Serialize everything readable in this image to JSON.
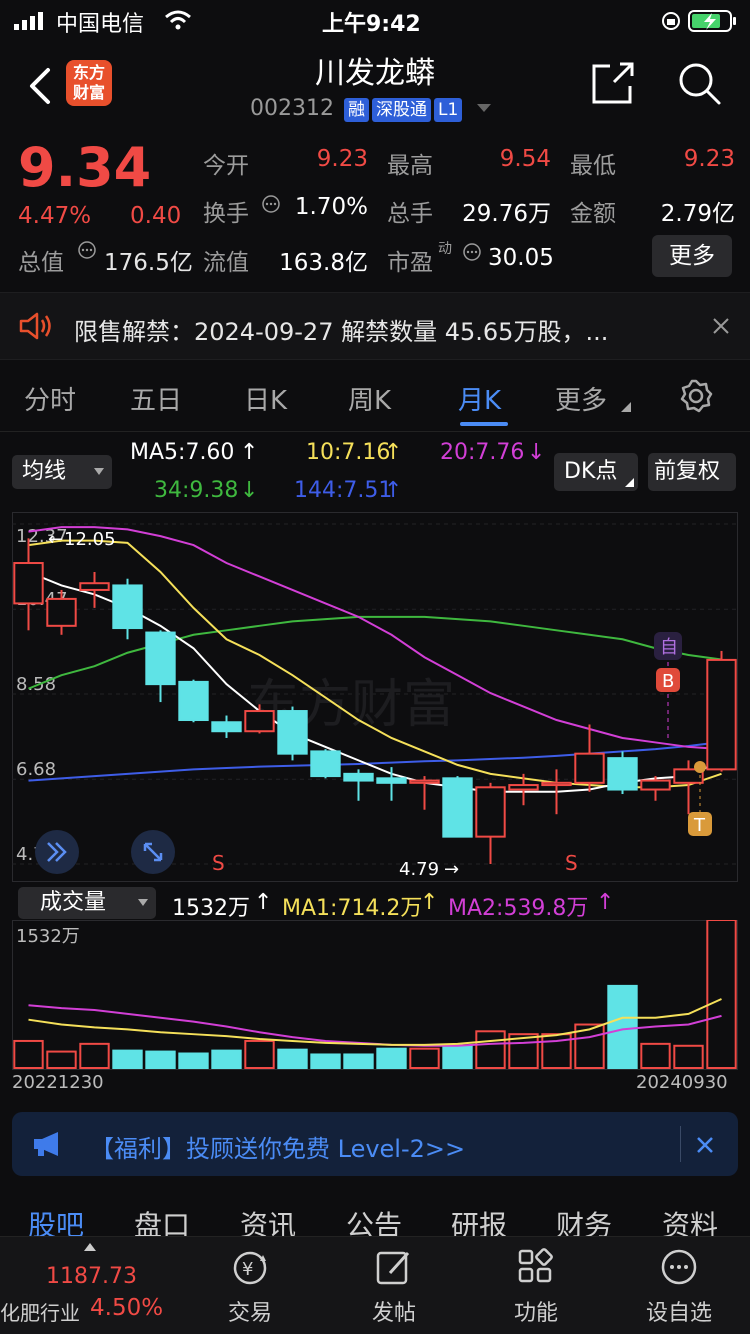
{
  "status_bar": {
    "carrier": "中国电信",
    "time": "上午9:42"
  },
  "header": {
    "logo_text": "东方财富",
    "title": "川发龙蟒",
    "code": "002312",
    "tags": [
      "融",
      "深股通",
      "L1"
    ]
  },
  "quote": {
    "price": "9.34",
    "change_pct": "4.47%",
    "change": "0.40",
    "fields": {
      "open_label": "今开",
      "open": "9.23",
      "high_label": "最高",
      "high": "9.54",
      "low_label": "最低",
      "low": "9.23",
      "turnover_label": "换手",
      "turnover": "1.70%",
      "volume_label": "总手",
      "volume": "29.76万",
      "amount_label": "金额",
      "amount": "2.79亿",
      "mktcap_label": "总值",
      "mktcap": "176.5亿",
      "float_label": "流值",
      "float": "163.8亿",
      "pe_label": "市盈",
      "pe_sup": "动",
      "pe": "30.05"
    },
    "more_button": "更多"
  },
  "notice": {
    "text": "限售解禁：2024-09-27 解禁数量 45.65万股，..."
  },
  "period_tabs": [
    "分时",
    "五日",
    "日K",
    "周K",
    "月K",
    "更多"
  ],
  "indicators": {
    "ma_selector": "均线",
    "ma5": "MA5:7.60",
    "ma10": "10:7.16",
    "ma20": "20:7.76",
    "ma34": "34:9.38",
    "ma144": "144:7.51",
    "dk_button": "DK点",
    "adjust_button": "前复权",
    "colors": {
      "ma5": "#ffffff",
      "ma10": "#f5e05a",
      "ma20": "#d23fd6",
      "ma34": "#3fb83f",
      "ma144": "#3e5de8",
      "up": "#f04a45",
      "down": "#5fe3e6"
    }
  },
  "chart_data": [
    {
      "type": "candlestick",
      "title": "",
      "y_ticks": [
        "12.37",
        "10.47",
        "8.58",
        "6.68",
        "4.79"
      ],
      "ylim": [
        4.79,
        12.37
      ],
      "annotations": {
        "high_marker": "12.05",
        "low_marker": "4.79",
        "s_marks": [
          "S",
          "S"
        ],
        "b_mark": "B",
        "t_mark": "T",
        "watermark": "东方财富",
        "self_mark": "自"
      },
      "candles": [
        {
          "o": 10.6,
          "h": 12.05,
          "l": 10.0,
          "c": 11.5
        },
        {
          "o": 10.1,
          "h": 10.9,
          "l": 9.9,
          "c": 10.7
        },
        {
          "o": 10.9,
          "h": 11.3,
          "l": 10.5,
          "c": 11.05
        },
        {
          "o": 11.0,
          "h": 11.15,
          "l": 9.8,
          "c": 10.05
        },
        {
          "o": 9.95,
          "h": 10.0,
          "l": 8.4,
          "c": 8.8
        },
        {
          "o": 8.85,
          "h": 8.9,
          "l": 7.95,
          "c": 8.0
        },
        {
          "o": 7.95,
          "h": 8.1,
          "l": 7.6,
          "c": 7.75
        },
        {
          "o": 7.75,
          "h": 8.35,
          "l": 7.7,
          "c": 8.2
        },
        {
          "o": 8.2,
          "h": 8.3,
          "l": 7.1,
          "c": 7.25
        },
        {
          "o": 7.3,
          "h": 7.35,
          "l": 6.7,
          "c": 6.75
        },
        {
          "o": 6.8,
          "h": 6.9,
          "l": 6.2,
          "c": 6.65
        },
        {
          "o": 6.7,
          "h": 6.95,
          "l": 6.2,
          "c": 6.6
        },
        {
          "o": 6.6,
          "h": 6.75,
          "l": 6.0,
          "c": 6.65
        },
        {
          "o": 6.7,
          "h": 6.75,
          "l": 5.4,
          "c": 5.4
        },
        {
          "o": 5.4,
          "h": 6.6,
          "l": 4.79,
          "c": 6.5
        },
        {
          "o": 6.45,
          "h": 6.8,
          "l": 6.1,
          "c": 6.55
        },
        {
          "o": 6.55,
          "h": 6.9,
          "l": 5.9,
          "c": 6.6
        },
        {
          "o": 6.6,
          "h": 7.9,
          "l": 6.4,
          "c": 7.25
        },
        {
          "o": 7.15,
          "h": 7.3,
          "l": 6.35,
          "c": 6.45
        },
        {
          "o": 6.45,
          "h": 6.75,
          "l": 6.2,
          "c": 6.65
        },
        {
          "o": 6.6,
          "h": 7.1,
          "l": 5.9,
          "c": 6.9
        },
        {
          "o": 6.9,
          "h": 9.54,
          "l": 6.85,
          "c": 9.34
        }
      ],
      "ma_lines": {
        "ma5": [
          11.3,
          11.0,
          10.8,
          10.5,
          10.1,
          9.6,
          8.8,
          8.2,
          7.7,
          7.4,
          7.1,
          6.8,
          6.6,
          6.5,
          6.4,
          6.4,
          6.4,
          6.45,
          6.6,
          6.7,
          6.75,
          7.1
        ],
        "ma10": [
          11.9,
          12.0,
          12.0,
          11.95,
          11.3,
          10.5,
          9.8,
          9.45,
          9.0,
          8.5,
          8.0,
          7.6,
          7.3,
          7.0,
          6.8,
          6.7,
          6.6,
          6.55,
          6.5,
          6.5,
          6.55,
          6.8
        ],
        "ma20": [
          12.2,
          12.3,
          12.3,
          12.25,
          12.1,
          11.9,
          11.5,
          11.2,
          10.9,
          10.6,
          10.3,
          9.9,
          9.4,
          9.0,
          8.6,
          8.3,
          8.0,
          7.8,
          7.6,
          7.5,
          7.4,
          7.35
        ],
        "ma34": [
          8.7,
          9.0,
          9.2,
          9.5,
          9.7,
          9.9,
          10.0,
          10.1,
          10.2,
          10.25,
          10.3,
          10.3,
          10.3,
          10.25,
          10.2,
          10.1,
          10.0,
          9.9,
          9.8,
          9.6,
          9.45,
          9.35
        ],
        "ma144": [
          6.65,
          6.7,
          6.75,
          6.8,
          6.85,
          6.9,
          6.93,
          6.96,
          6.98,
          7.0,
          7.02,
          7.05,
          7.08,
          7.1,
          7.13,
          7.16,
          7.2,
          7.25,
          7.3,
          7.35,
          7.42,
          7.51
        ]
      }
    },
    {
      "type": "bar",
      "title": "",
      "y_top_label": "1532万",
      "x_start_label": "20221230",
      "x_end_label": "20240930",
      "volumes": [
        280,
        170,
        250,
        180,
        170,
        150,
        180,
        280,
        190,
        140,
        140,
        200,
        200,
        230,
        380,
        350,
        350,
        450,
        850,
        250,
        230,
        1532
      ],
      "ma1": [
        500,
        450,
        420,
        400,
        370,
        350,
        330,
        300,
        280,
        260,
        250,
        240,
        240,
        250,
        280,
        310,
        340,
        400,
        520,
        520,
        560,
        714.2
      ],
      "ma2": [
        650,
        620,
        600,
        560,
        520,
        480,
        430,
        370,
        320,
        280,
        260,
        240,
        230,
        230,
        250,
        260,
        280,
        320,
        400,
        430,
        450,
        539.8
      ]
    }
  ],
  "volume_bar": {
    "selector": "成交量",
    "vol": "1532万",
    "ma1": "MA1:714.2万",
    "ma2": "MA2:539.8万"
  },
  "promo": {
    "text": "【福利】投顾送你免费 Level-2>>"
  },
  "sections": [
    "股吧",
    "盘口",
    "资讯",
    "公告",
    "研报",
    "财务",
    "资料"
  ],
  "bottom_nav": {
    "industry_value": "1187.73",
    "industry_name": "化肥行业",
    "industry_pct": "4.50%",
    "items": [
      "交易",
      "发帖",
      "功能",
      "设自选"
    ]
  }
}
